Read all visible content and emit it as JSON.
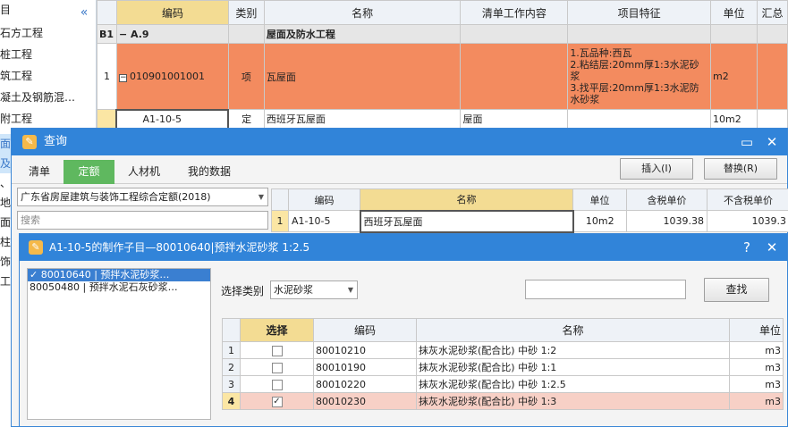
{
  "tree": {
    "items": [
      "目",
      "石方工程",
      "桩工程",
      "筑工程",
      "凝土及钢筋混…",
      "附工程",
      "面及",
      "、",
      "地面",
      "柱",
      "饰工"
    ],
    "collapse_icon": "double-chevron-left"
  },
  "grid": {
    "headers": [
      "编码",
      "类别",
      "名称",
      "清单工作内容",
      "项目特征",
      "单位",
      "汇总"
    ],
    "rows": [
      {
        "idx": "B1",
        "code": "− A.9",
        "type": "",
        "name": "屋面及防水工程",
        "content": "",
        "feature": "",
        "unit": ""
      },
      {
        "idx": "1",
        "code": "010901001001",
        "type": "项",
        "name": "瓦屋面",
        "content": "",
        "feature": [
          "1.瓦品种:西瓦",
          "2.粘结层:20mm厚1:3水泥砂浆",
          "3.找平层:20mm厚1:3水泥防水砂浆"
        ],
        "unit": "m2"
      },
      {
        "idx": "",
        "code": "A1-10-5",
        "type": "定",
        "name": "西班牙瓦屋面",
        "content": "屋面",
        "feature": "",
        "unit": "10m2"
      }
    ]
  },
  "query_dialog": {
    "title": "查询",
    "tabs": [
      "清单",
      "定额",
      "人材机",
      "我的数据"
    ],
    "active_tab": "定额",
    "insert_label": "插入(I)",
    "replace_label": "替换(R)",
    "library": "广东省房屋建筑与装饰工程综合定额(2018)",
    "search_placeholder": "搜索",
    "quota_headers": [
      "编码",
      "名称",
      "单位",
      "含税单价",
      "不含税单价"
    ],
    "quota_row": {
      "idx": "1",
      "code": "A1-10-5",
      "name": "西班牙瓦屋面",
      "unit": "10m2",
      "tax_price": "1039.38",
      "notax_price": "1039.3"
    }
  },
  "sub_dialog": {
    "title": "A1-10-5的制作子目—80010640|预拌水泥砂浆  1:2.5",
    "help": "?",
    "close": "✕",
    "subitems": [
      "80010640 | 预拌水泥砂浆…",
      "80050480 | 预拌水泥石灰砂浆…"
    ],
    "type_label": "选择类别",
    "type_value": "水泥砂浆",
    "find_label": "查找",
    "headers": [
      "选择",
      "编码",
      "名称",
      "单位"
    ],
    "rows": [
      {
        "idx": "1",
        "checked": false,
        "code": "80010210",
        "name": "抹灰水泥砂浆(配合比) 中砂 1:2",
        "unit": "m3"
      },
      {
        "idx": "2",
        "checked": false,
        "code": "80010190",
        "name": "抹灰水泥砂浆(配合比) 中砂 1:1",
        "unit": "m3"
      },
      {
        "idx": "3",
        "checked": false,
        "code": "80010220",
        "name": "抹灰水泥砂浆(配合比) 中砂 1:2.5",
        "unit": "m3"
      },
      {
        "idx": "4",
        "checked": true,
        "code": "80010230",
        "name": "抹灰水泥砂浆(配合比) 中砂 1:3",
        "unit": "m3"
      }
    ]
  },
  "colors": {
    "accent": "#3184d9",
    "orange_row": "#f38b5f",
    "active_tab": "#5fb85f",
    "selected_row": "#f7d0c6",
    "header_hl": "#f3dc93"
  }
}
